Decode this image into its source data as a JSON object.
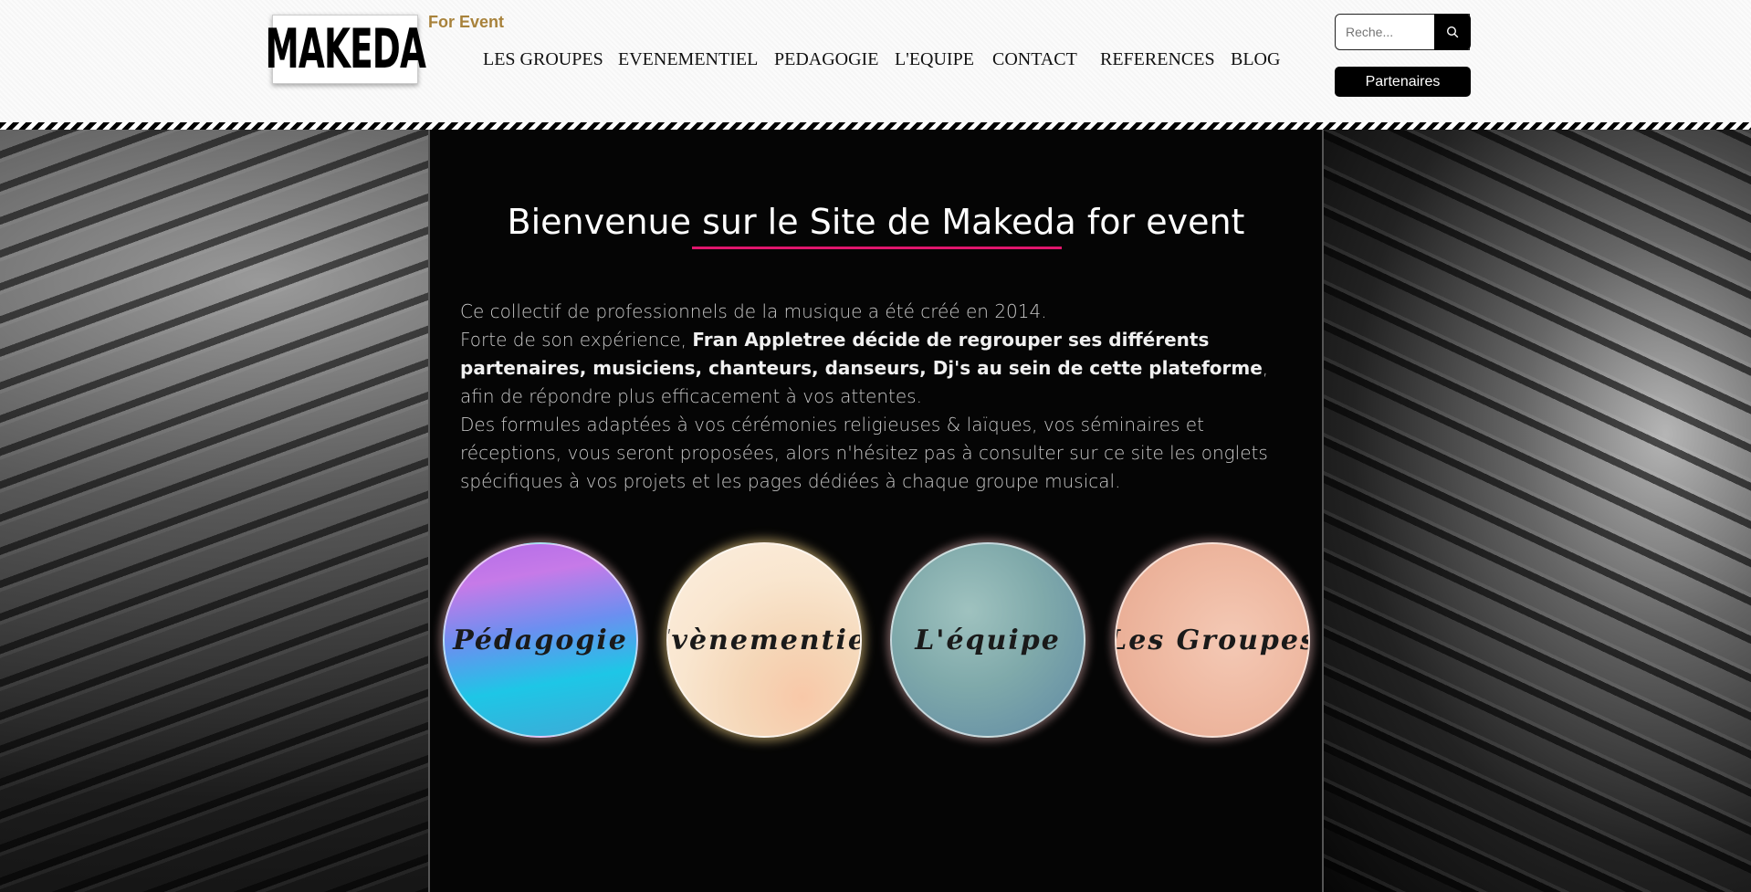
{
  "header": {
    "logo_text": "MAKEDA",
    "tagline": "For Event",
    "nav": [
      {
        "label": "LES GROUPES"
      },
      {
        "label": "EVENEMENTIEL"
      },
      {
        "label": "PEDAGOGIE"
      },
      {
        "label": "L'EQUIPE"
      },
      {
        "label": "CONTACT"
      },
      {
        "label": "REFERENCES"
      },
      {
        "label": "BLOG"
      }
    ],
    "search": {
      "placeholder": "Reche..."
    },
    "partners_label": "Partenaires"
  },
  "main": {
    "title": "Bienvenue sur le Site de Makeda for event",
    "intro": {
      "line1": "Ce collectif de professionnels de la musique a été créé en 2014.",
      "line2_pre": "Forte de son expérience, ",
      "line2_bold": "Fran Appletree décide de regrouper ses différents partenaires, musiciens, chanteurs, danseurs, Dj's au sein de cette plateforme",
      "line2_post": ", afin de répondre plus efficacement à vos attentes.",
      "line3": "Des formules adaptées à vos cérémonies religieuses & laïques, vos séminaires et réceptions, vous seront proposées, alors n'hésitez pas à consulter sur ce site les onglets spécifiques à vos projets et les pages dédiées à chaque groupe musical."
    },
    "circles": [
      {
        "label": "Pédagogie"
      },
      {
        "label": "Évènementiel"
      },
      {
        "label": "L'équipe"
      },
      {
        "label": "Les Groupes"
      }
    ]
  },
  "colors": {
    "accent_divider": "#e0166d",
    "tagline_gold": "#a8823b"
  }
}
